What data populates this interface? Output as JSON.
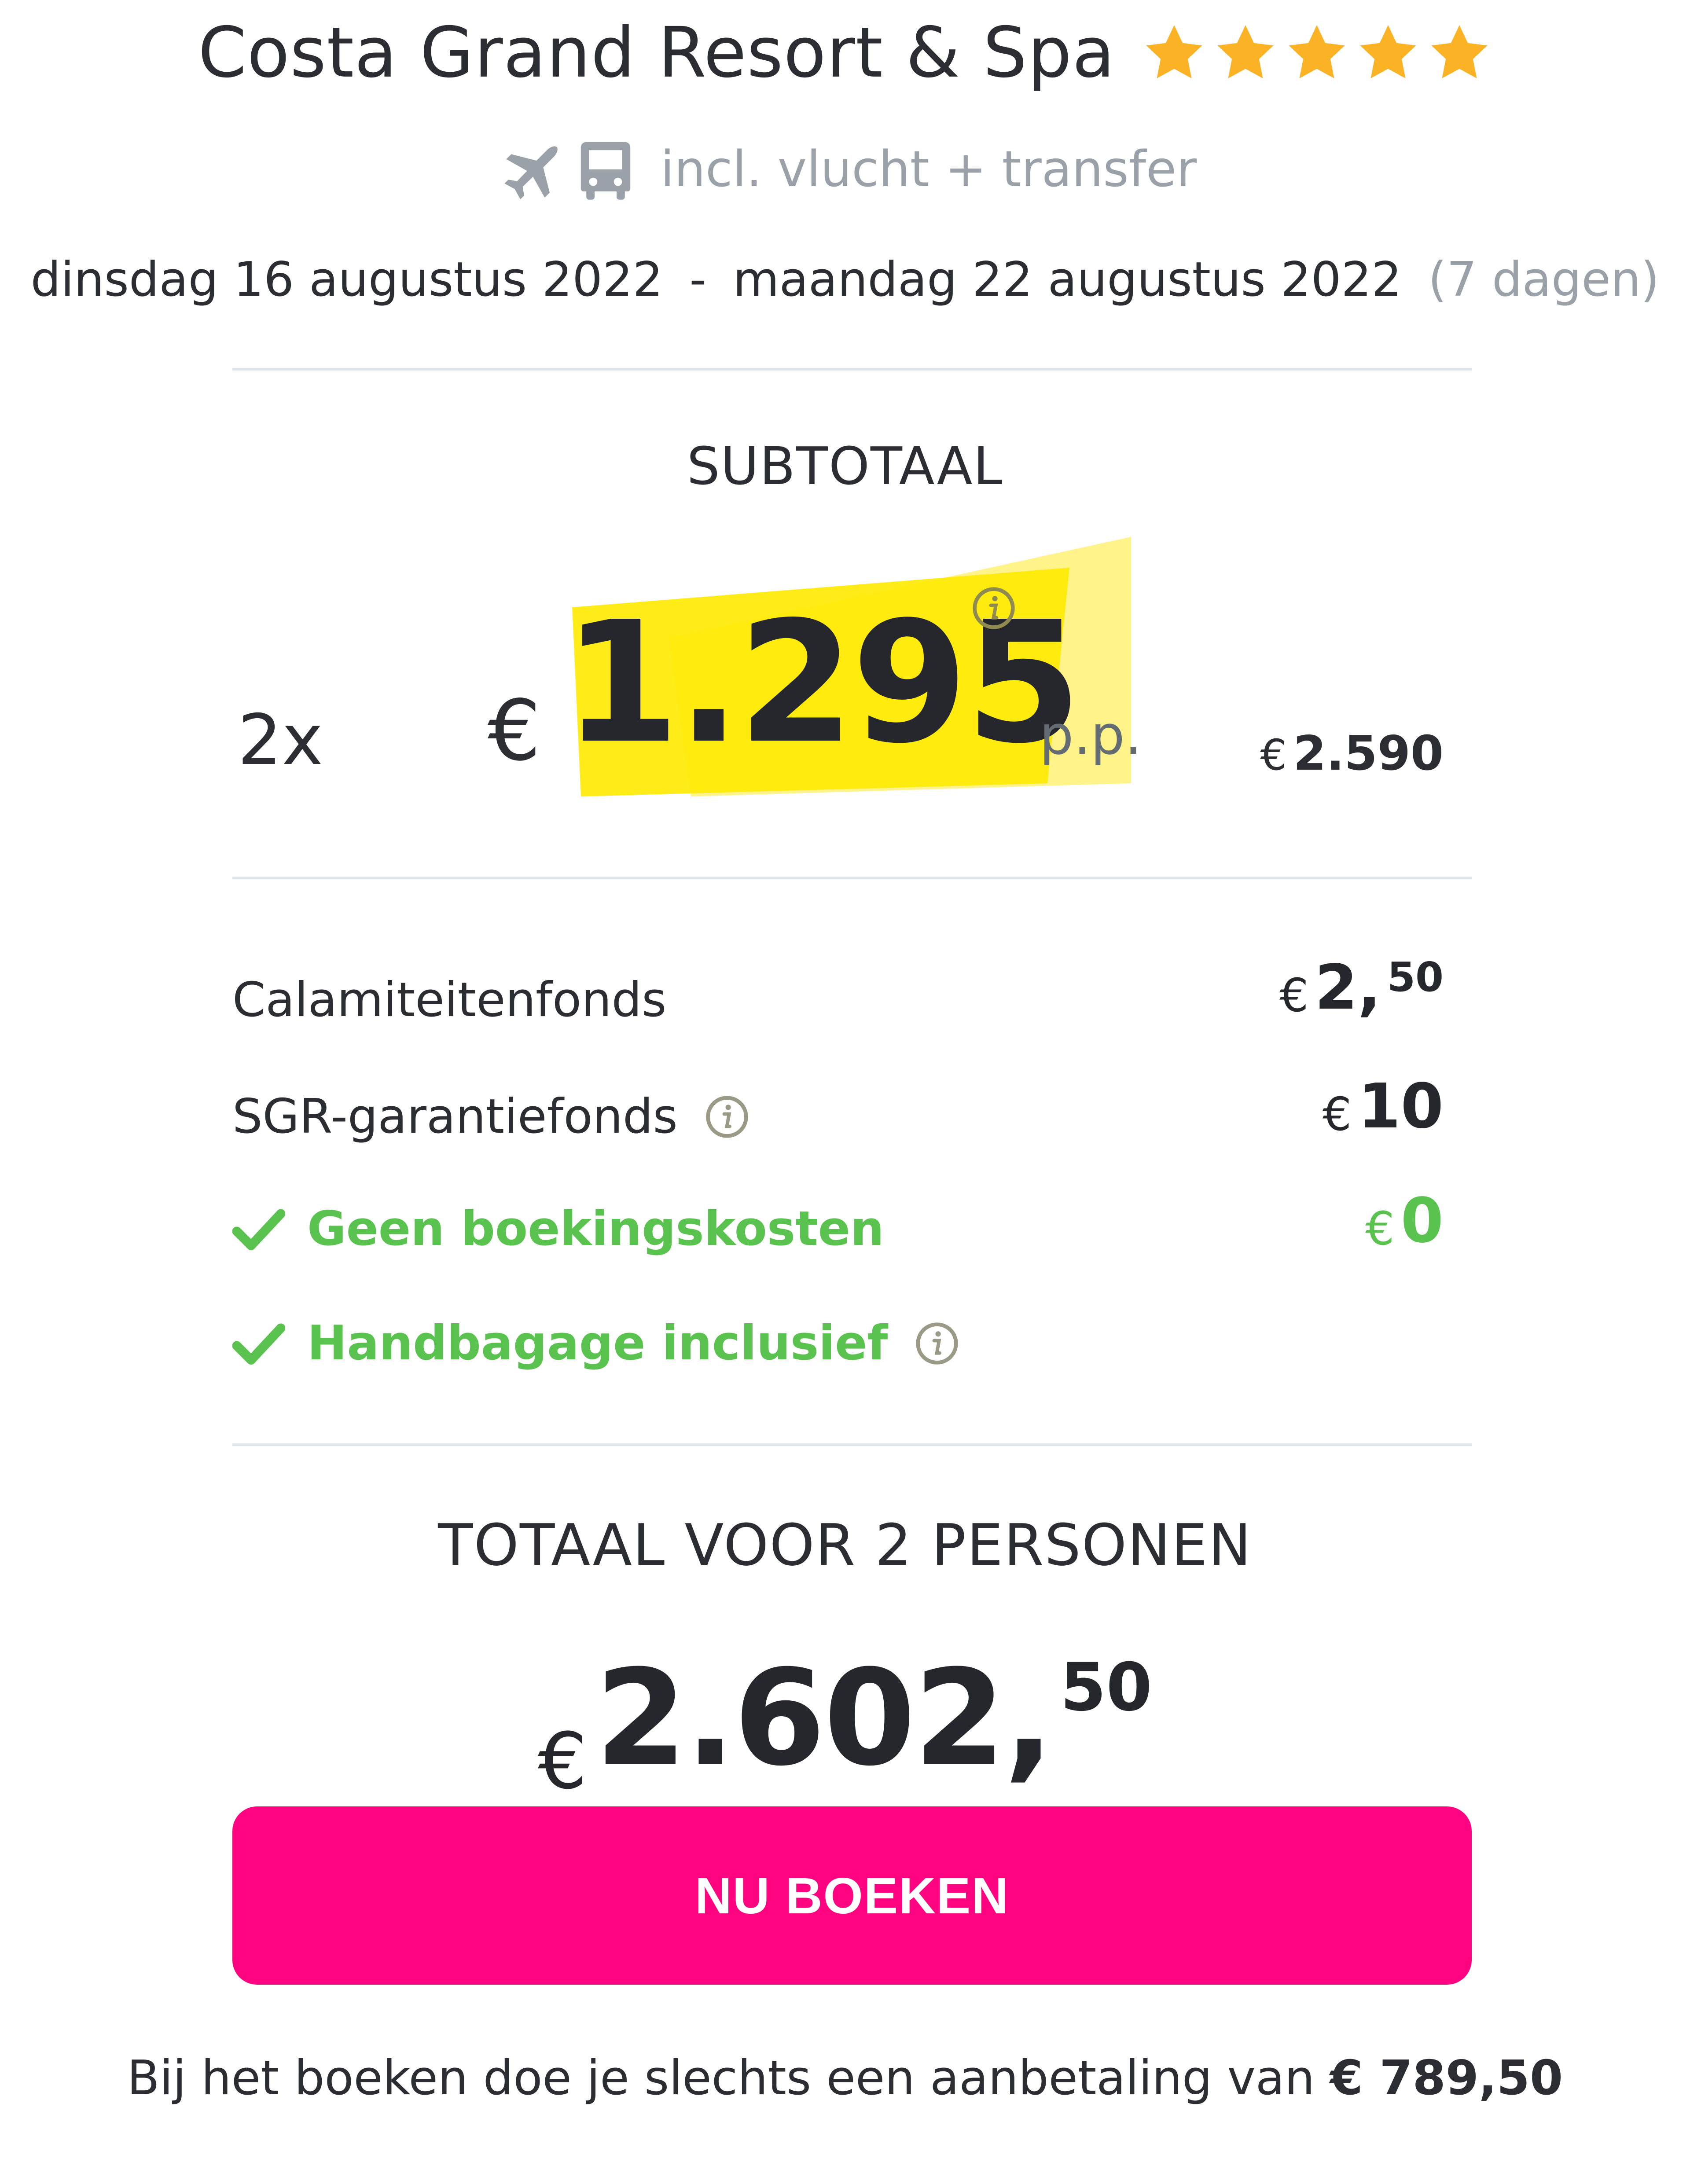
{
  "hotel": {
    "name": "Costa Grand Resort & Spa",
    "stars": 5,
    "star_color": "#fbb224"
  },
  "transport": {
    "label": "incl. vlucht + transfer",
    "icons": [
      "airplane-icon",
      "bus-icon"
    ]
  },
  "dates": {
    "start": "dinsdag 16 augustus 2022",
    "separator": "-",
    "end": "maandag 22 augustus 2022",
    "duration": "(7 dagen)"
  },
  "subtotal": {
    "heading": "SUBTOTAAL",
    "quantity": "2x",
    "currency": "€",
    "price_pp": "1.295",
    "unit": "p.p.",
    "total_currency": "€",
    "total": "2.590",
    "highlight_color": "#ffea00"
  },
  "costs": [
    {
      "label": "Calamiteitenfonds",
      "currency": "€",
      "value": "2,",
      "decimals": "50",
      "info": false
    },
    {
      "label": "SGR-garantiefonds",
      "currency": "€",
      "value": "10",
      "decimals": "",
      "info": true
    }
  ],
  "included": [
    {
      "label": "Geen boekingskosten",
      "currency": "€",
      "value": "0"
    },
    {
      "label": "Handbagage inclusief",
      "info": true
    }
  ],
  "total": {
    "heading": "TOTAAL VOOR 2 PERSONEN",
    "currency": "€",
    "value": "2.602,",
    "decimals": "50"
  },
  "cta": {
    "label": "NU BOEKEN",
    "color": "#ff0381"
  },
  "deposit": {
    "text": "Bij het boeken doe je slechts een aanbetaling van ",
    "amount": "€ 789,50"
  },
  "colors": {
    "text": "#2b2d33",
    "muted": "#9aa1a9",
    "green": "#5ac24f",
    "divider": "#dfe7ec"
  }
}
